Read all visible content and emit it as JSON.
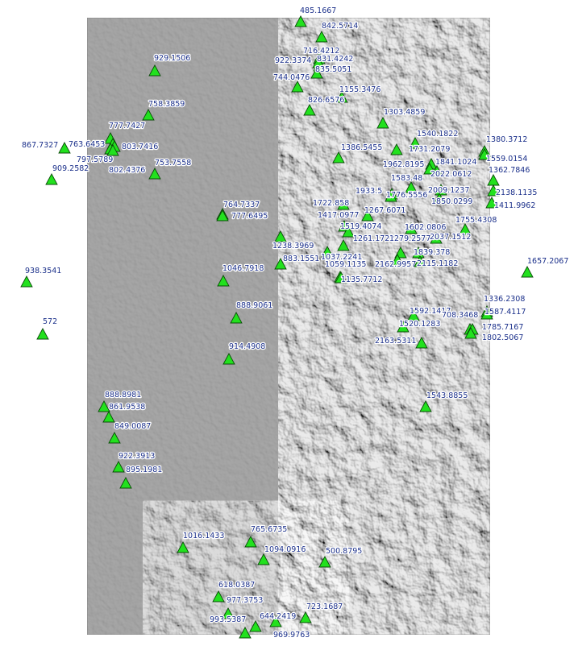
{
  "map": {
    "relief_colors": {
      "background": "#ffffff",
      "relief_base": "#8f8f8f",
      "relief_light": "#e6e6e6",
      "relief_dark": "#2e2e2e"
    },
    "marker_style": {
      "icon": "triangle-marker-icon",
      "fill": "#22e11e",
      "stroke": "#0a4a08",
      "label_color": "#1a2f8a"
    },
    "stations": [
      {
        "label": "485.1667"
      },
      {
        "label": "842.5714"
      },
      {
        "label": "716.4212"
      },
      {
        "label": "922.3374"
      },
      {
        "label": "831.4242"
      },
      {
        "label": "835.5051"
      },
      {
        "label": "744.0476"
      },
      {
        "label": "1155.3476"
      },
      {
        "label": "929.1506"
      },
      {
        "label": "758.3859"
      },
      {
        "label": "826.6576"
      },
      {
        "label": "1303.4859"
      },
      {
        "label": "777.7427"
      },
      {
        "label": "867.7327"
      },
      {
        "label": "763.6453"
      },
      {
        "label": "803.7416"
      },
      {
        "label": "797.5789"
      },
      {
        "label": "802.4376"
      },
      {
        "label": "909.2582"
      },
      {
        "label": "753.7558"
      },
      {
        "label": "1540.1822"
      },
      {
        "label": "1380.3712"
      },
      {
        "label": "1386.5455"
      },
      {
        "label": "1731.2079"
      },
      {
        "label": "1559.0154"
      },
      {
        "label": "1841.1024"
      },
      {
        "label": "1962.8195"
      },
      {
        "label": "2022.0612"
      },
      {
        "label": "1362.7846"
      },
      {
        "label": "1583.48"
      },
      {
        "label": "2009.1237"
      },
      {
        "label": "1933.5"
      },
      {
        "label": "1776.5556"
      },
      {
        "label": "2138.1135"
      },
      {
        "label": "1850.0299"
      },
      {
        "label": "1722.858"
      },
      {
        "label": "1411.9962"
      },
      {
        "label": "764.7337"
      },
      {
        "label": "777.6495"
      },
      {
        "label": "1267.6071"
      },
      {
        "label": "1417.0977"
      },
      {
        "label": "1755.4308"
      },
      {
        "label": "1519.4074"
      },
      {
        "label": "1602.0806"
      },
      {
        "label": "2037.1512"
      },
      {
        "label": "1238.3969"
      },
      {
        "label": "1261.1722"
      },
      {
        "label": "1279.2577"
      },
      {
        "label": "1037.2241"
      },
      {
        "label": "1839.378"
      },
      {
        "label": "883.1551"
      },
      {
        "label": "1059.1135"
      },
      {
        "label": "2162.9957"
      },
      {
        "label": "2115.1182"
      },
      {
        "label": "1657.2067"
      },
      {
        "label": "938.3541"
      },
      {
        "label": "1046.7918"
      },
      {
        "label": "1135.7712"
      },
      {
        "label": "572"
      },
      {
        "label": "1336.2308"
      },
      {
        "label": "888.9061"
      },
      {
        "label": "1587.4117"
      },
      {
        "label": "1592.1417"
      },
      {
        "label": "708.3468"
      },
      {
        "label": "1520.1283"
      },
      {
        "label": "1785.7167"
      },
      {
        "label": "1802.5067"
      },
      {
        "label": "2163.5311"
      },
      {
        "label": "914.4908"
      },
      {
        "label": "1543.8855"
      },
      {
        "label": "888.8981"
      },
      {
        "label": "861.9538"
      },
      {
        "label": "849.0087"
      },
      {
        "label": "922.3913"
      },
      {
        "label": "895.1981"
      },
      {
        "label": "765.6735"
      },
      {
        "label": "1016.1433"
      },
      {
        "label": "1094.0916"
      },
      {
        "label": "500.8795"
      },
      {
        "label": "618.0387"
      },
      {
        "label": "977.3753"
      },
      {
        "label": "723.1687"
      },
      {
        "label": "644.2419"
      },
      {
        "label": "993.5387"
      },
      {
        "label": "969.9763"
      }
    ]
  }
}
